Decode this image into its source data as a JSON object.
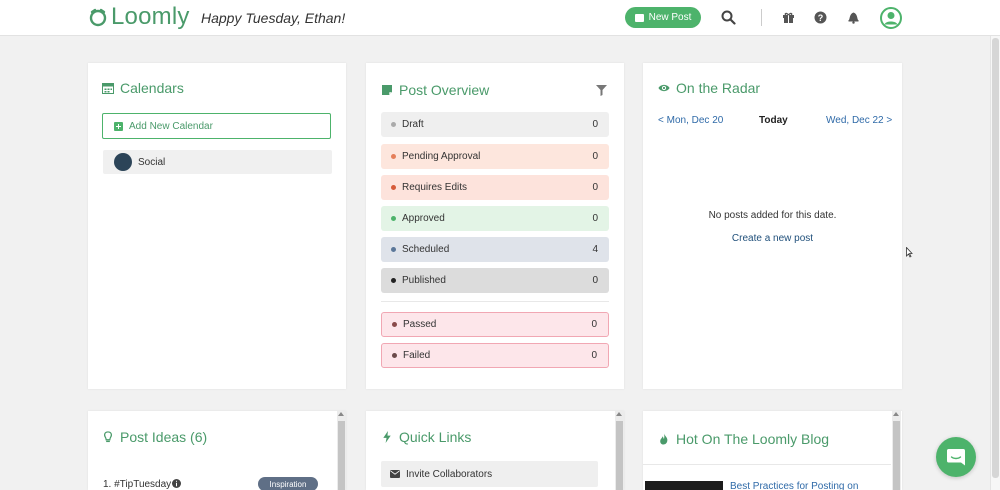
{
  "header": {
    "logo_text": "Loomly",
    "greeting": "Happy Tuesday, Ethan!",
    "new_post_label": "New Post",
    "icons": [
      "search-icon",
      "gift-icon",
      "help-icon",
      "bell-icon",
      "user-avatar-icon"
    ]
  },
  "calendars": {
    "title": "Calendars",
    "add_label": "Add New Calendar",
    "items": [
      {
        "name": "Social"
      }
    ]
  },
  "post_overview": {
    "title": "Post Overview",
    "statuses": [
      {
        "label": "Draft",
        "count": "0",
        "color": "#aaaaaa"
      },
      {
        "label": "Pending Approval",
        "count": "0",
        "color": "#e57f5a"
      },
      {
        "label": "Requires Edits",
        "count": "0",
        "color": "#d65b3a"
      },
      {
        "label": "Approved",
        "count": "0",
        "color": "#4db36b"
      },
      {
        "label": "Scheduled",
        "count": "4",
        "color": "#5b7799"
      },
      {
        "label": "Published",
        "count": "0",
        "color": "#222222"
      },
      {
        "label": "Passed",
        "count": "0",
        "color": "#8a4a4a"
      },
      {
        "label": "Failed",
        "count": "0",
        "color": "#6b4a4a"
      }
    ]
  },
  "radar": {
    "title": "On the Radar",
    "prev_label": "< Mon, Dec 20",
    "today_label": "Today",
    "next_label": "Wed, Dec 22 >",
    "empty_text": "No posts added for this date.",
    "create_link": "Create a new post"
  },
  "post_ideas": {
    "title": "Post Ideas (6)",
    "first_item": "1. #TipTuesday",
    "first_tag": "Inspiration"
  },
  "quick_links": {
    "title": "Quick Links",
    "first_link": "Invite Collaborators"
  },
  "blog": {
    "title": "Hot On The Loomly Blog",
    "first_post": "Best Practices for Posting on"
  },
  "colors": {
    "brand": "#4a9a6a",
    "button": "#4db36b"
  }
}
